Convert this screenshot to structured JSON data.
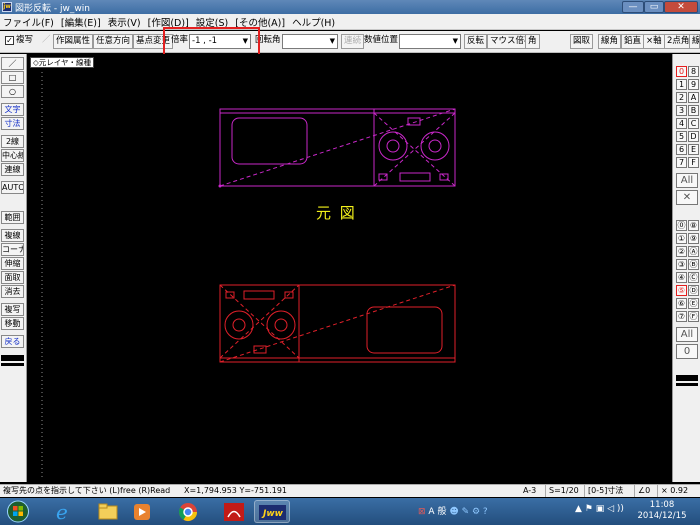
{
  "window": {
    "app_icon_text": "jw",
    "title": "図形反転 - jw_win",
    "buttons": {
      "minimize": "—",
      "maximize": "▭",
      "close": "✕"
    }
  },
  "menu": [
    "ファイル(F)",
    "[編集(E)]",
    "表示(V)",
    "[作図(D)]",
    "設定(S)",
    "[その他(A)]",
    "ヘルプ(H)"
  ],
  "toolbar": {
    "fukusha_label": "複写",
    "sakuzu_zokusei": "作図属性",
    "nin_i_houkou": "任意方向",
    "kiten_henkou": "基点変更",
    "bairitsu_label": "倍率",
    "bairitsu_value": "-1 , -1",
    "kaiten_label": "回転角",
    "kaiten_value": "",
    "renzoku": "連続",
    "suuchi_label": "数値位置",
    "suuchi_value": "",
    "hanten": "反転",
    "mouse_bairitsu": "マウス倍率",
    "kaku": "角",
    "right_buttons": [
      "図取",
      "線角",
      "鉛直",
      "×軸",
      "2点角",
      "線"
    ]
  },
  "left_tools": [
    {
      "label": "／",
      "color": "#000000"
    },
    {
      "label": "□",
      "color": "#000000"
    },
    {
      "label": "○",
      "color": "#000000"
    },
    {
      "label": "文字",
      "color": "#1530c8"
    },
    {
      "label": "寸法",
      "color": "#1530c8"
    },
    {
      "label": "2線",
      "color": "#000000"
    },
    {
      "label": "中心線",
      "color": "#000000"
    },
    {
      "label": "連線",
      "color": "#000000"
    },
    {
      "label": "AUTO",
      "color": "#000000"
    },
    {
      "label": "範囲",
      "color": "#000000"
    },
    {
      "label": "複線",
      "color": "#000000"
    },
    {
      "label": "コーナー",
      "color": "#000000"
    },
    {
      "label": "伸縮",
      "color": "#000000"
    },
    {
      "label": "面取",
      "color": "#000000"
    },
    {
      "label": "消去",
      "color": "#000000"
    },
    {
      "label": "複写",
      "color": "#000000"
    },
    {
      "label": "移動",
      "color": "#000000"
    },
    {
      "label": "戻る",
      "color": "#1530c8"
    }
  ],
  "right_tools": {
    "layer_groups": [
      "0",
      "8",
      "1",
      "9",
      "2",
      "A",
      "3",
      "B",
      "4",
      "C",
      "5",
      "D",
      "6",
      "E",
      "7",
      "F"
    ],
    "all_label_top": "All",
    "x_label": "✕",
    "layers": [
      "⓪",
      "⑧",
      "①",
      "⑨",
      "②",
      "Ⓐ",
      "③",
      "Ⓑ",
      "④",
      "Ⓒ",
      "⑤",
      "Ⓓ",
      "⑥",
      "Ⓔ",
      "⑦",
      "Ⓕ"
    ],
    "all_label_bottom": "All",
    "zero_label": "0"
  },
  "canvas": {
    "layer_tab": "◇元レイヤ・線種",
    "label_original": "元 図",
    "colors": {
      "original": "#c928c9",
      "copy": "#e0202a",
      "label": "#f2f01a"
    }
  },
  "status": {
    "message": "複写先の点を指示して下さい (L)free (R)Read",
    "coords": "X=1,794.953  Y=-751.191",
    "layer": "A-3",
    "scale": "S=1/20",
    "dim": "[0-5]寸法",
    "angle": "∠0",
    "zoom": "× 0.92"
  },
  "taskbar": {
    "tray_text": "A 般",
    "time": "11:08",
    "date": "2014/12/15"
  }
}
